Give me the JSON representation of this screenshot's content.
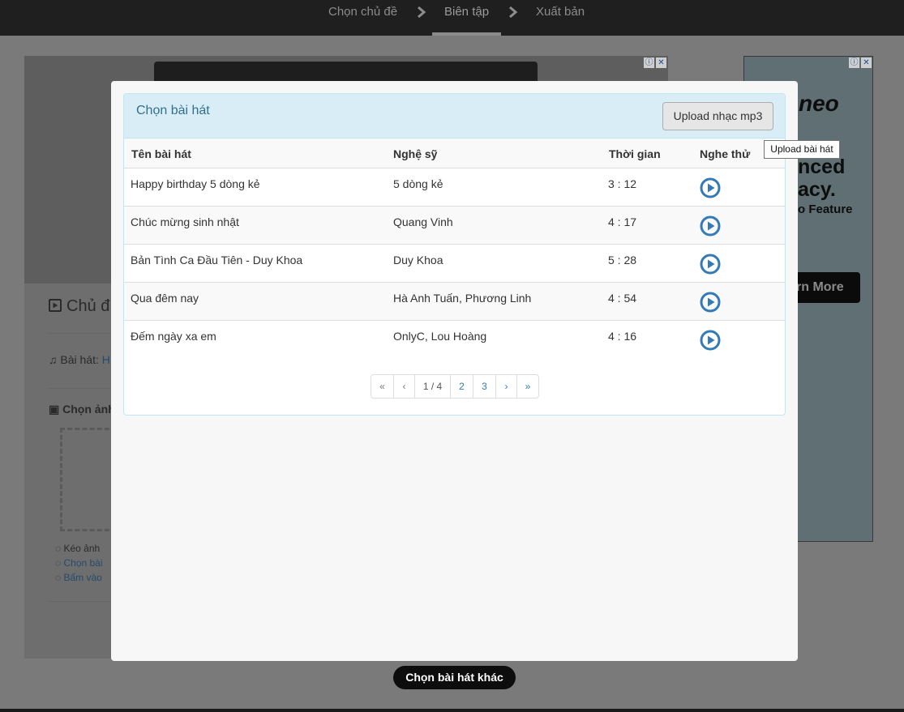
{
  "stepper": {
    "step1": "Chọn chủ đề",
    "step2": "Biên tập",
    "step3": "Xuất bản"
  },
  "background": {
    "section_title": "Chủ đ",
    "song_label": "Bài hát:",
    "song_link": "H",
    "choose_image": "Chọn ảnh",
    "tip1": "Kéo ảnh",
    "tip2": "Chọn bài",
    "tip3": "Bấm vào"
  },
  "ad": {
    "brand": "neo",
    "line1": "nced",
    "line2": "acy.",
    "line3": "o Feature",
    "button": "rn More"
  },
  "bottom_button": "Chọn bài hát khác",
  "modal": {
    "title": "Chọn bài hát",
    "upload_button": "Upload nhạc mp3",
    "tooltip": "Upload bài hát",
    "columns": [
      "Tên bài hát",
      "Nghệ sỹ",
      "Thời gian",
      "Nghe thử"
    ],
    "songs": [
      {
        "name": "Happy birthday 5 dòng kẻ",
        "artist": "5 dòng kẻ",
        "duration": "3 : 12"
      },
      {
        "name": "Chúc mừng sinh nhật",
        "artist": "Quang Vinh",
        "duration": "4 : 17"
      },
      {
        "name": "Bản Tình Ca Đầu Tiên - Duy Khoa",
        "artist": "Duy Khoa",
        "duration": "5 : 28"
      },
      {
        "name": "Qua đêm nay",
        "artist": "Hà Anh Tuấn, Phương Linh",
        "duration": "4 : 54"
      },
      {
        "name": "Đếm ngày xa em",
        "artist": "OnlyC, Lou Hoàng",
        "duration": "4 : 16"
      }
    ],
    "pagination": {
      "first": "«",
      "prev": "‹",
      "current": "1 / 4",
      "page2": "2",
      "page3": "3",
      "next": "›",
      "last": "»"
    }
  },
  "colors": {
    "panel_heading_bg": "#d9edf7",
    "panel_title": "#31708f",
    "play_icon": "#337ab7"
  }
}
